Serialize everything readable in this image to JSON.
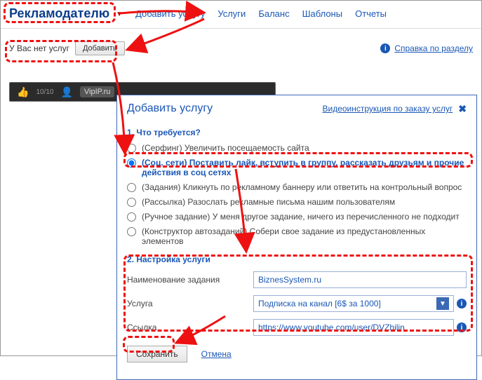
{
  "nav": {
    "main": "Рекламодателю",
    "links": [
      "Добавить услугу",
      "Услуги",
      "Баланс",
      "Шаблоны",
      "Отчеты"
    ]
  },
  "second": {
    "noserv": "У Вас нет услуг",
    "add": "Добавить",
    "help": "Справка по разделу"
  },
  "video": {
    "score": "10/10",
    "name": "VipIP.ru"
  },
  "dialog": {
    "title": "Добавить услугу",
    "video_link": "Видеоинструкция по заказу услуг",
    "sec1": "1. Что требуется?",
    "options": [
      "(Серфинг) Увеличить посещаемость сайта",
      "(Соц. сети) Поставить лайк, вступить в группу, рассказать друзьям и прочие действия в соц сетях",
      "(Задания) Кликнуть по рекламному баннеру или ответить на контрольный вопрос",
      "(Рассылка) Разослать рекламные письма нашим пользователям",
      "(Ручное задание) У меня другое задание, ничего из перечисленного не подходит",
      "(Конструктор автозаданий) Собери свое задание из предустановленных элементов"
    ],
    "sec2": "2. Настройка услуги",
    "form": {
      "name_label": "Наименование задания",
      "name_value": "BiznesSystem.ru",
      "service_label": "Услуга",
      "service_value": "Подписка на канал [6$ за 1000]",
      "link_label": "Ссылка",
      "link_value": "https://www.youtube.com/user/DVZhilin"
    },
    "save": "Сохранить",
    "cancel": "Отмена"
  }
}
